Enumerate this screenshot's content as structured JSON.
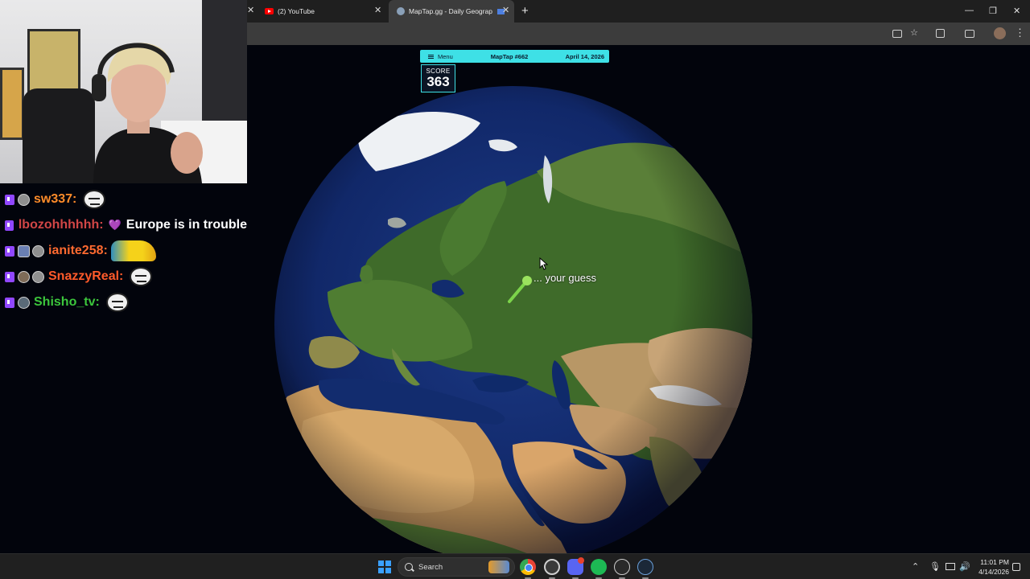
{
  "chat": {
    "messages": [
      {
        "user": "sw337:",
        "color": "#ff8c2a",
        "text": "",
        "emote": "pepe-stare",
        "badges": [
          "sub-badge-gray"
        ]
      },
      {
        "user": "lbozohhhhhh:",
        "color": "#d24646",
        "text": "Europe is in trouble",
        "emote": "purple-heart",
        "badges": []
      },
      {
        "user": "ianite258:",
        "color": "#ff6a30",
        "text": "",
        "emote": "pikachu",
        "badges": [
          "sub-badge-blue",
          "sub-badge-gray"
        ]
      },
      {
        "user": "SnazzyReal:",
        "color": "#ff5a2a",
        "text": "",
        "emote": "pepe-stare",
        "badges": [
          "sub-badge-brown",
          "sub-badge-gray"
        ]
      },
      {
        "user": "Shisho_tv:",
        "color": "#3cc63c",
        "text": "",
        "emote": "pepe-stare",
        "badges": [
          "sub-badge-slate"
        ]
      }
    ]
  },
  "browser": {
    "tabs": [
      {
        "label": "(2) YouTube",
        "icon": "youtube-icon",
        "active": false
      },
      {
        "label": "MapTap.gg - Daily Geograp",
        "icon": "globe-icon",
        "active": true
      }
    ],
    "new_tab": "+",
    "window_controls": {
      "minimize": "—",
      "maximize": "❐",
      "close": "✕"
    }
  },
  "game": {
    "menu_label": "Menu",
    "puzzle_number": "MapTap #662",
    "date": "April 14, 2026",
    "score_label": "SCORE",
    "score_value": "363",
    "guess_label": "... your guess",
    "accent_color": "#3ee0e6"
  },
  "taskbar": {
    "search_label": "Search",
    "apps": [
      "chrome-icon",
      "obs-icon",
      "discord-icon",
      "spotify-icon",
      "streamer-app-icon",
      "steam-icon"
    ],
    "clock_time": "11:01 PM",
    "clock_date": "4/14/2026"
  }
}
